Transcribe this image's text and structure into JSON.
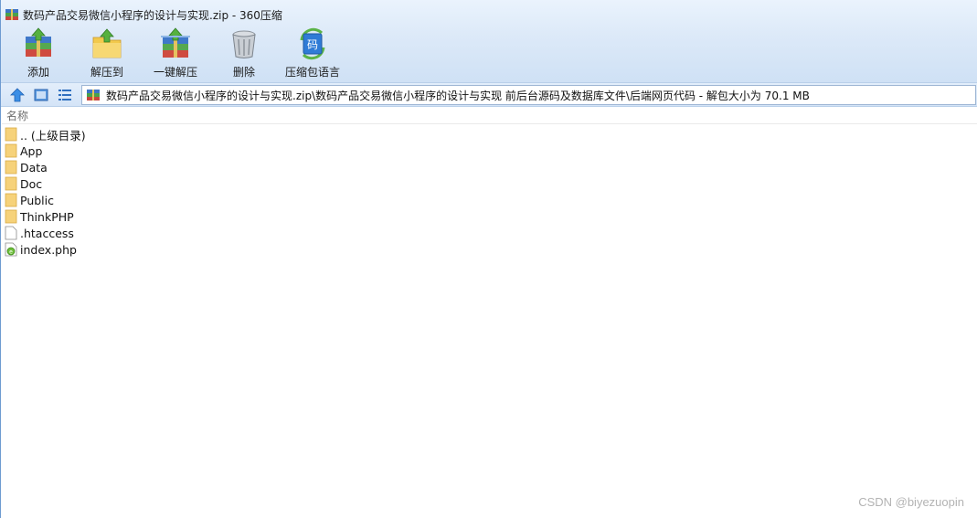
{
  "window": {
    "title": "数码产品交易微信小程序的设计与实现.zip - 360压缩"
  },
  "toolbar": {
    "buttons": [
      {
        "label": "添加",
        "icon": "add-archive-icon"
      },
      {
        "label": "解压到",
        "icon": "extract-to-icon"
      },
      {
        "label": "一键解压",
        "icon": "one-click-extract-icon"
      },
      {
        "label": "删除",
        "icon": "delete-icon"
      },
      {
        "label": "压缩包语言",
        "icon": "archive-language-icon"
      }
    ]
  },
  "navbar": {
    "address": "数码产品交易微信小程序的设计与实现.zip\\数码产品交易微信小程序的设计与实现 前后台源码及数据库文件\\后端网页代码 - 解包大小为 70.1 MB"
  },
  "filelist": {
    "column_name": "名称",
    "items": [
      {
        "name": ".. (上级目录)",
        "type": "folder"
      },
      {
        "name": "App",
        "type": "folder"
      },
      {
        "name": "Data",
        "type": "folder"
      },
      {
        "name": "Doc",
        "type": "folder"
      },
      {
        "name": "Public",
        "type": "folder"
      },
      {
        "name": "ThinkPHP",
        "type": "folder"
      },
      {
        "name": ".htaccess",
        "type": "file"
      },
      {
        "name": "index.php",
        "type": "php"
      }
    ]
  },
  "watermark": "CSDN @biyezuopin",
  "colors": {
    "folder": "#f6d27a",
    "chrome_top": "#eaf3fd",
    "chrome_bottom": "#cfe1f5",
    "accent_blue": "#2f7bd6"
  }
}
